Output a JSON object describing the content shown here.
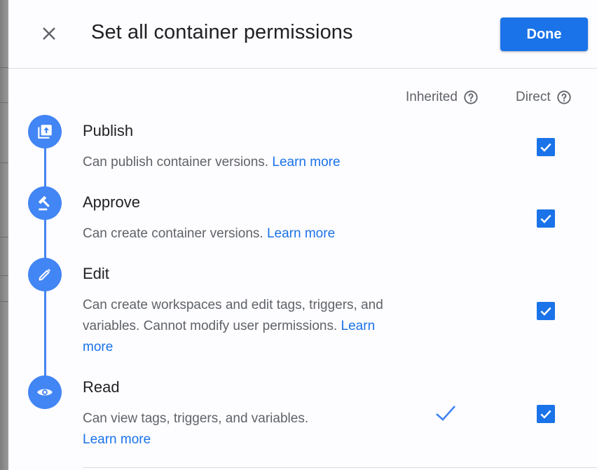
{
  "dialog": {
    "title": "Set all container permissions",
    "done_label": "Done"
  },
  "columns": {
    "inherited": "Inherited",
    "direct": "Direct"
  },
  "permissions": [
    {
      "name": "Publish",
      "icon": "publish-icon",
      "description": "Can publish container versions.",
      "learn_more": "Learn more",
      "inherited": false,
      "direct": true
    },
    {
      "name": "Approve",
      "icon": "gavel-icon",
      "description": "Can create container versions.",
      "learn_more": "Learn more",
      "inherited": false,
      "direct": true
    },
    {
      "name": "Edit",
      "icon": "pencil-icon",
      "description": "Can create workspaces and edit tags, triggers, and variables. Cannot modify user permissions.",
      "learn_more": "Learn more",
      "inherited": false,
      "direct": true
    },
    {
      "name": "Read",
      "icon": "eye-icon",
      "description": "Can view tags, triggers, and variables.",
      "learn_more": "Learn more",
      "inherited": true,
      "direct": true
    }
  ],
  "colors": {
    "accent": "#1a73e8",
    "timeline": "#4285f4",
    "text_primary": "#202124",
    "text_secondary": "#5f6368"
  }
}
